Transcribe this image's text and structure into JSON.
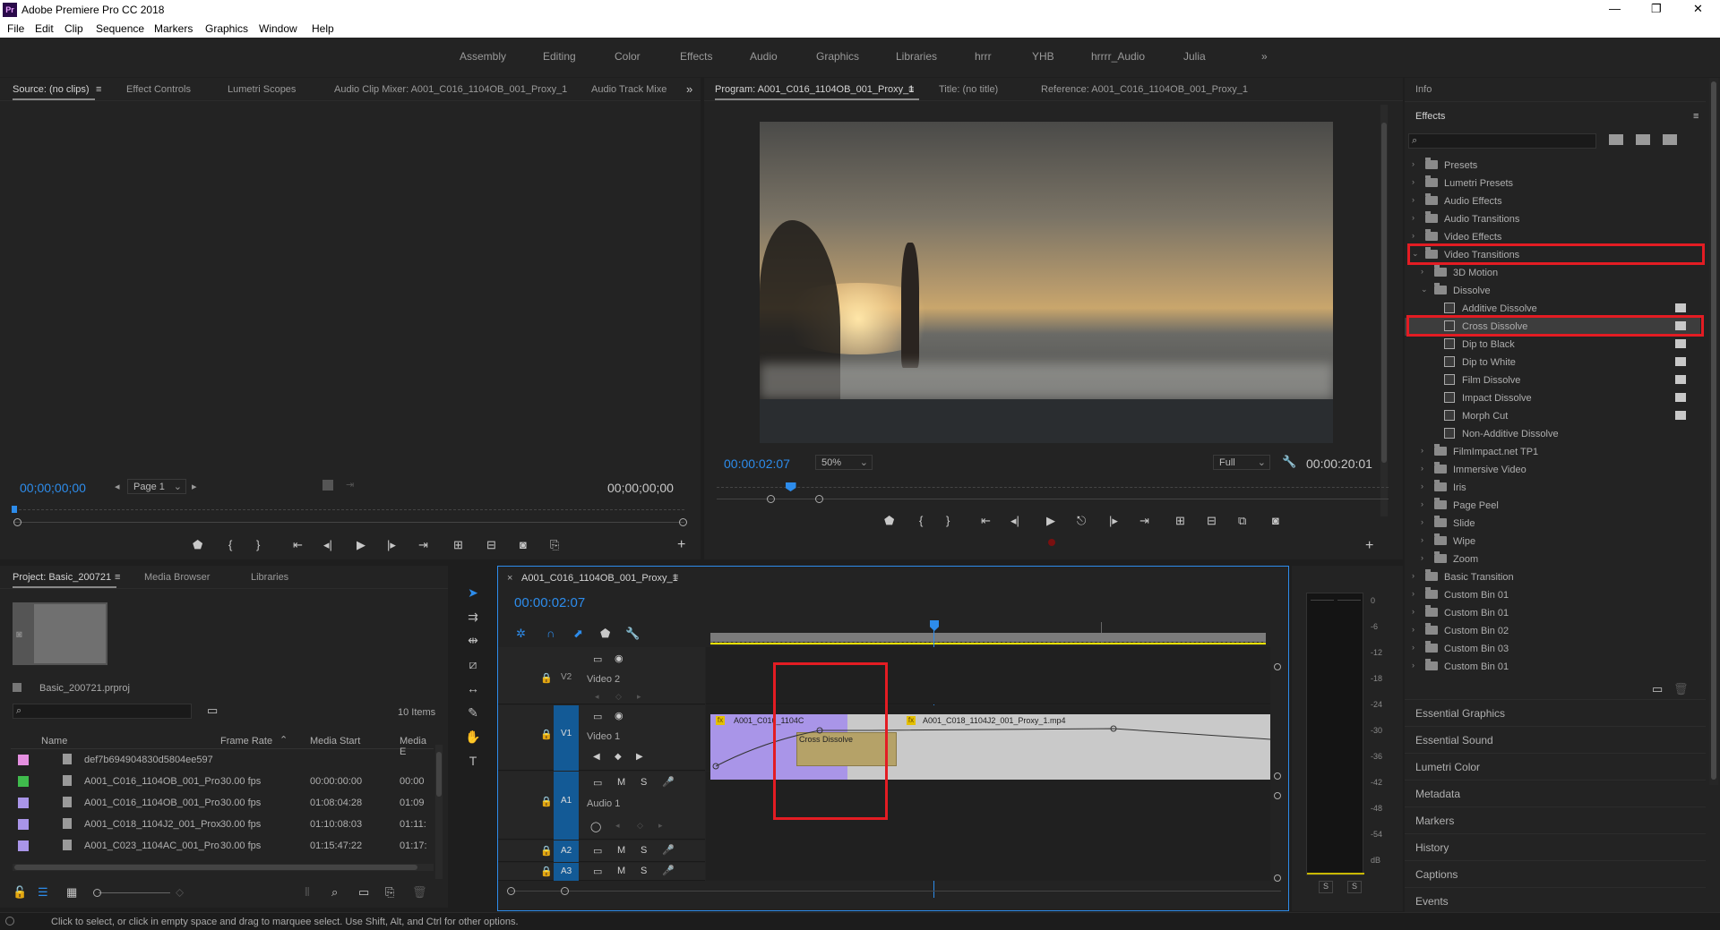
{
  "app": {
    "title": "Adobe Premiere Pro CC 2018",
    "logo": "Pr"
  },
  "menu": [
    "File",
    "Edit",
    "Clip",
    "Sequence",
    "Markers",
    "Graphics",
    "Window",
    "Help"
  ],
  "workspaces": [
    "Assembly",
    "Editing",
    "Color",
    "Effects",
    "Audio",
    "Graphics",
    "Libraries",
    "hrrr",
    "YHB",
    "hrrrr_Audio",
    "Julia",
    "»"
  ],
  "source_panel": {
    "tabs": [
      "Source: (no clips)",
      "Effect Controls",
      "Lumetri Scopes",
      "Audio Clip Mixer: A001_C016_1104OB_001_Proxy_1",
      "Audio Track Mixe"
    ],
    "timecode_in": "00;00;00;00",
    "timecode_out": "00;00;00;00",
    "page_select": "Page 1"
  },
  "program_panel": {
    "tabs": [
      "Program: A001_C016_1104OB_001_Proxy_1",
      "Title: (no title)",
      "Reference: A001_C016_1104OB_001_Proxy_1"
    ],
    "timecode": "00:00:02:07",
    "zoom": "50%",
    "quality": "Full",
    "duration": "00:00:20:01",
    "playhead_fraction": 0.11
  },
  "right_panel": {
    "info_tab": "Info",
    "effects_tab": "Effects",
    "tree": [
      {
        "label": "Presets",
        "level": 0,
        "type": "folder"
      },
      {
        "label": "Lumetri Presets",
        "level": 0,
        "type": "folder"
      },
      {
        "label": "Audio Effects",
        "level": 0,
        "type": "folder"
      },
      {
        "label": "Audio Transitions",
        "level": 0,
        "type": "folder"
      },
      {
        "label": "Video Effects",
        "level": 0,
        "type": "folder"
      },
      {
        "label": "Video Transitions",
        "level": 0,
        "type": "folder",
        "open": true
      },
      {
        "label": "3D Motion",
        "level": 1,
        "type": "folder"
      },
      {
        "label": "Dissolve",
        "level": 1,
        "type": "folder",
        "open": true
      },
      {
        "label": "Additive Dissolve",
        "level": 2,
        "type": "item",
        "badge": true
      },
      {
        "label": "Cross Dissolve",
        "level": 2,
        "type": "item",
        "badge": true,
        "selected": true
      },
      {
        "label": "Dip to Black",
        "level": 2,
        "type": "item",
        "badge": true
      },
      {
        "label": "Dip to White",
        "level": 2,
        "type": "item",
        "badge": true
      },
      {
        "label": "Film Dissolve",
        "level": 2,
        "type": "item",
        "badge": true
      },
      {
        "label": "Impact Dissolve",
        "level": 2,
        "type": "item",
        "badge": true
      },
      {
        "label": "Morph Cut",
        "level": 2,
        "type": "item",
        "badge": true
      },
      {
        "label": "Non-Additive Dissolve",
        "level": 2,
        "type": "item"
      },
      {
        "label": "FilmImpact.net TP1",
        "level": 1,
        "type": "folder"
      },
      {
        "label": "Immersive Video",
        "level": 1,
        "type": "folder"
      },
      {
        "label": "Iris",
        "level": 1,
        "type": "folder"
      },
      {
        "label": "Page Peel",
        "level": 1,
        "type": "folder"
      },
      {
        "label": "Slide",
        "level": 1,
        "type": "folder"
      },
      {
        "label": "Wipe",
        "level": 1,
        "type": "folder"
      },
      {
        "label": "Zoom",
        "level": 1,
        "type": "folder"
      },
      {
        "label": "Basic Transition",
        "level": 0,
        "type": "folder"
      },
      {
        "label": "Custom Bin 01",
        "level": 0,
        "type": "folder"
      },
      {
        "label": "Custom Bin 01",
        "level": 0,
        "type": "folder"
      },
      {
        "label": "Custom Bin 02",
        "level": 0,
        "type": "folder"
      },
      {
        "label": "Custom Bin 03",
        "level": 0,
        "type": "folder"
      },
      {
        "label": "Custom Bin 01",
        "level": 0,
        "type": "folder"
      }
    ],
    "collapsed_panels": [
      "Essential Graphics",
      "Essential Sound",
      "Lumetri Color",
      "Metadata",
      "Markers",
      "History",
      "Captions",
      "Events"
    ]
  },
  "project_panel": {
    "tabs": [
      "Project: Basic_200721",
      "Media Browser",
      "Libraries"
    ],
    "file": "Basic_200721.prproj",
    "count": "10 Items",
    "columns": [
      "Name",
      "Frame Rate",
      "Media Start",
      "Media E"
    ],
    "rows": [
      {
        "name": "def7b694904830d5804ee597",
        "rate": "",
        "start": "",
        "end": "",
        "color": "#e48fe0"
      },
      {
        "name": "A001_C016_1104OB_001_Pro",
        "rate": "30.00 fps",
        "start": "00:00:00:00",
        "end": "00:00",
        "color": "#3fbb4c"
      },
      {
        "name": "A001_C016_1104OB_001_Pro",
        "rate": "30.00 fps",
        "start": "01:08:04:28",
        "end": "01:09",
        "color": "#a995e8"
      },
      {
        "name": "A001_C018_1104J2_001_Prox",
        "rate": "30.00 fps",
        "start": "01:10:08:03",
        "end": "01:11:",
        "color": "#a995e8"
      },
      {
        "name": "A001_C023_1104AC_001_Pro",
        "rate": "30.00 fps",
        "start": "01:15:47:22",
        "end": "01:17:",
        "color": "#a995e8"
      }
    ]
  },
  "timeline": {
    "tab": "A001_C016_1104OB_001_Proxy_1",
    "timecode": "00:00:02:07",
    "tracks": [
      {
        "id": "V2",
        "name": "Video 2"
      },
      {
        "id": "V1",
        "name": "Video 1"
      },
      {
        "id": "A1",
        "name": "Audio 1"
      },
      {
        "id": "A2",
        "name": ""
      },
      {
        "id": "A3",
        "name": ""
      }
    ],
    "clip1_label": "A001_C016_1104C",
    "clip2_label": "A001_C018_1104J2_001_Proxy_1.mp4",
    "transition_label": "Cross Dissolve",
    "fx": "fx",
    "track_btn_m": "M",
    "track_btn_s": "S"
  },
  "audio_meter": {
    "labels": [
      "0",
      "-6",
      "-12",
      "-18",
      "-24",
      "-30",
      "-36",
      "-42",
      "-48",
      "-54",
      "dB"
    ],
    "solo": [
      "S",
      "S"
    ]
  },
  "status_bar": "Click to select, or click in empty space and drag to marquee select. Use Shift, Alt, and Ctrl for other options.",
  "colors": {
    "accent": "#2d8ceb",
    "highlight": "#e31c23",
    "video_clip": "#a995e8",
    "clip_gray": "#c9c9c9",
    "transition": "#b5a268"
  }
}
